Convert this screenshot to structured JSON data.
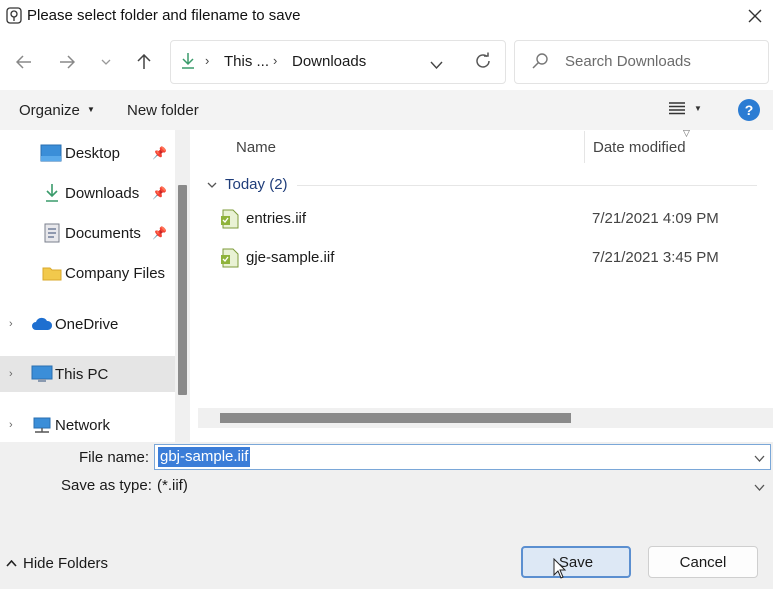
{
  "window": {
    "title": "Please select folder and filename to save"
  },
  "navigation": {
    "address_parts": [
      "This ...",
      "Downloads"
    ],
    "search_placeholder": "Search Downloads"
  },
  "toolbar": {
    "organize_label": "Organize",
    "new_folder_label": "New folder",
    "help_label": "?"
  },
  "sidebar": {
    "items": [
      {
        "label": "Desktop",
        "pinned": true,
        "icon": "desktop-icon"
      },
      {
        "label": "Downloads",
        "pinned": true,
        "icon": "download-icon"
      },
      {
        "label": "Documents",
        "pinned": true,
        "icon": "document-icon"
      },
      {
        "label": "Company Files",
        "pinned": false,
        "icon": "folder-icon"
      },
      {
        "label": "OneDrive",
        "pinned": false,
        "icon": "cloud-icon"
      },
      {
        "label": "This PC",
        "pinned": false,
        "icon": "computer-icon",
        "selected": true
      },
      {
        "label": "Network",
        "pinned": false,
        "icon": "network-icon"
      }
    ]
  },
  "file_list": {
    "columns": [
      "Name",
      "Date modified"
    ],
    "group": {
      "label": "Today (2)"
    },
    "files": [
      {
        "name": "entries.iif",
        "date_modified": "7/21/2021 4:09 PM"
      },
      {
        "name": "gje-sample.iif",
        "date_modified": "7/21/2021 3:45 PM"
      }
    ]
  },
  "form": {
    "file_name_label": "File name:",
    "file_name_value": "gbj-sample.iif",
    "save_type_label": "Save as type:",
    "save_type_value": "(*.iif)"
  },
  "footer": {
    "hide_folders_label": "Hide Folders",
    "save_label": "Save",
    "cancel_label": "Cancel"
  },
  "colors": {
    "accent": "#2b7cd3",
    "selection": "#3b7dd8",
    "folder": "#f2c94c"
  }
}
